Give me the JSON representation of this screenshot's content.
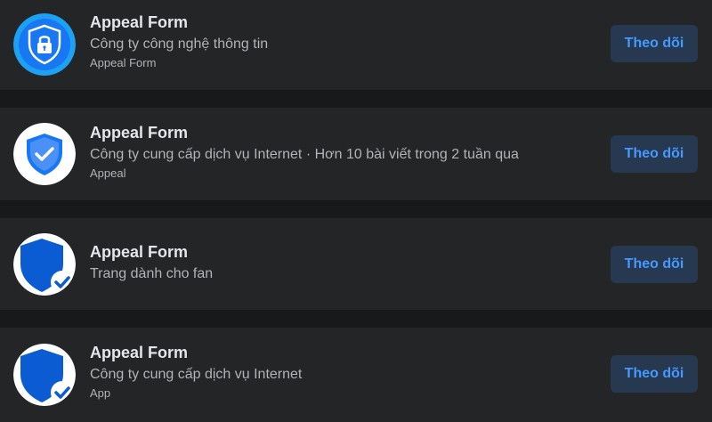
{
  "pages": [
    {
      "name": "Appeal Form",
      "subtitle": "Công ty công nghệ thông tin",
      "meta": "Appeal Form",
      "follow_label": "Theo dõi",
      "avatar_icon": "lock-shield-icon"
    },
    {
      "name": "Appeal Form",
      "subtitle": "Công ty cung cấp dịch vụ Internet · Hơn 10 bài viết trong 2 tuần qua",
      "meta": "Appeal",
      "follow_label": "Theo dõi",
      "avatar_icon": "check-shield-icon"
    },
    {
      "name": "Appeal Form",
      "subtitle": "Trang dành cho fan",
      "meta": "",
      "follow_label": "Theo dõi",
      "avatar_icon": "shield-check-icon"
    },
    {
      "name": "Appeal Form",
      "subtitle": "Công ty cung cấp dịch vụ Internet",
      "meta": "App",
      "follow_label": "Theo dõi",
      "avatar_icon": "shield-check-icon"
    }
  ],
  "colors": {
    "background": "#18191a",
    "card": "#242526",
    "primary_text": "#e4e6eb",
    "secondary_text": "#b0b3b8",
    "follow_bg": "#263951",
    "follow_text": "#4599ff",
    "shield_blue": "#1877f2"
  }
}
